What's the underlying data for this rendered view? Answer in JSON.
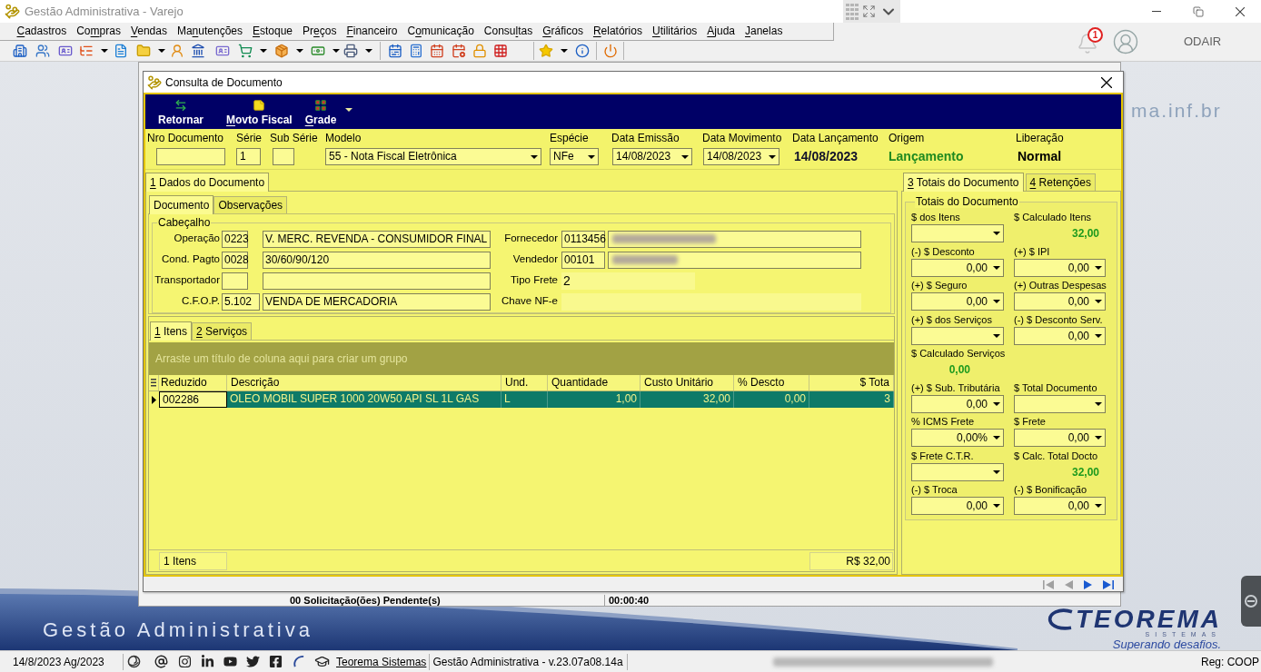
{
  "app_window": {
    "title": "Gestão Administrativa - Varejo"
  },
  "menu": [
    {
      "key": "C",
      "after": "adastros"
    },
    {
      "before": "Co",
      "key": "m",
      "after": "pras"
    },
    {
      "key": "V",
      "after": "endas"
    },
    {
      "before": "Ma",
      "key": "n",
      "after": "utenções"
    },
    {
      "key": "E",
      "after": "stoque"
    },
    {
      "before": "Pr",
      "key": "e",
      "after": "ços"
    },
    {
      "key": "F",
      "after": "inanceiro"
    },
    {
      "before": "C",
      "key": "o",
      "after": "municação"
    },
    {
      "before": "Consu",
      "key": "l",
      "after": "tas"
    },
    {
      "key": "G",
      "after": "ráficos"
    },
    {
      "key": "R",
      "after": "elatórios"
    },
    {
      "key": "U",
      "after": "tilitários"
    },
    {
      "key": "A",
      "after": "juda"
    },
    {
      "key": "J",
      "after": "anelas"
    }
  ],
  "user_area": {
    "notification_count": "1",
    "user_name": "ODAIR"
  },
  "desktop": {
    "website_fragment": "ma.inf.br",
    "background_window": {
      "pending_requests": "00 Solicitação(ões) Pendente(s)",
      "elapsed_time": "00:00:40"
    },
    "product_name": "Gestão Administrativa",
    "brand": "TEOREMA",
    "brand_tagline": "SISTEMAS",
    "slogan": "Superando desafios."
  },
  "dialog": {
    "title": "Consulta de Documento",
    "toolbar": [
      {
        "label": "Retornar",
        "dropdown": false
      },
      {
        "key": "M",
        "after": "ovto Fiscal",
        "dropdown": false
      },
      {
        "key": "G",
        "after": "rade",
        "dropdown": true
      }
    ],
    "header_fields": [
      {
        "kind": "input",
        "label": "Nro Documento"
      },
      {
        "kind": "input",
        "label": "Série",
        "value": "1"
      },
      {
        "kind": "input",
        "label": "Sub Série"
      },
      {
        "kind": "select",
        "label": "Modelo",
        "value": "55 - Nota Fiscal Eletrônica"
      },
      {
        "kind": "select",
        "label": "Espécie",
        "value": "NFe"
      },
      {
        "kind": "date",
        "label": "Data Emissão",
        "value": "14/08/2023"
      },
      {
        "kind": "date",
        "label": "Data Movimento",
        "value": "14/08/2023"
      },
      {
        "kind": "display",
        "label": "Data Lançamento",
        "value": "14/08/2023",
        "color": "#10102a"
      },
      {
        "kind": "display",
        "label": "Origem",
        "value": "Lançamento",
        "color": "#1f8a1f"
      },
      {
        "kind": "display",
        "label": "Liberação",
        "value": "Normal",
        "color": "#000000"
      }
    ],
    "left_panel": {
      "tabs": [
        {
          "key": "1",
          "after": " Dados do Documento",
          "selected": true
        }
      ],
      "document_tabs": [
        {
          "label": "Documento",
          "selected": true
        },
        {
          "label": "Observações",
          "selected": false
        }
      ],
      "cabecalho": {
        "title": "Cabeçalho",
        "left_rows": [
          {
            "label": "Operação",
            "code": "0223",
            "description": "V. MERC. REVENDA - CONSUMIDOR FINAL"
          },
          {
            "label": "Cond. Pagto",
            "code": "0028",
            "description": "30/60/90/120"
          },
          {
            "label": "Transportador"
          },
          {
            "label": "C.F.O.P.",
            "code": "5.102",
            "description": "VENDA DE MERCADORIA"
          }
        ],
        "right_rows": [
          {
            "kind": "lookup",
            "label": "Fornecedor",
            "code": "0113456",
            "redacted": true
          },
          {
            "kind": "lookup",
            "label": "Vendedor",
            "code": "00101",
            "redacted": true
          },
          {
            "kind": "readonly",
            "label": "Tipo Frete",
            "value": "2"
          },
          {
            "kind": "readonly",
            "label": "Chave NF-e"
          }
        ]
      },
      "item_tabs": [
        {
          "key": "1",
          "after": " Itens",
          "selected": true
        },
        {
          "key": "2",
          "after": " Serviços",
          "selected": false
        }
      ],
      "group_by_hint": "Arraste um título de coluna aqui para criar um grupo",
      "grid": {
        "columns": [
          "Reduzido",
          "Descrição",
          "Und.",
          "Quantidade",
          "Custo Unitário",
          "% Descto",
          "$ Tota"
        ],
        "rows": [
          {
            "selected": true,
            "cells": [
              "002286",
              "OLEO MOBIL SUPER 1000 20W50 API SL 1L GAS",
              "L",
              "1,00",
              "32,00",
              "0,00",
              "3"
            ]
          }
        ],
        "footer": {
          "count": "1 Itens",
          "total": "R$ 32,00"
        }
      }
    },
    "right_panel": {
      "tabs": [
        {
          "key": "3",
          "after": " Totais do Documento",
          "selected": true
        },
        {
          "key": "4",
          "after": " Retenções",
          "selected": false
        }
      ],
      "group_title": "Totais do Documento",
      "rows": [
        {
          "fields": [
            {
              "kind": "dropdown",
              "label": "$ dos Itens"
            },
            {
              "kind": "value",
              "label": "$ Calculado Itens",
              "value": "32,00"
            }
          ]
        },
        {
          "fields": [
            {
              "kind": "dropdown",
              "label": "(-) $ Desconto",
              "value": "0,00"
            },
            {
              "kind": "dropdown",
              "label": "(+) $ IPI",
              "value": "0,00"
            }
          ]
        },
        {
          "fields": [
            {
              "kind": "dropdown",
              "label": "(+) $ Seguro",
              "value": "0,00"
            },
            {
              "kind": "dropdown",
              "label": "(+) Outras Despesas",
              "value": "0,00"
            }
          ]
        },
        {
          "fields": [
            {
              "kind": "dropdown",
              "label": "(+) $ dos Serviços"
            },
            {
              "kind": "dropdown",
              "label": "(-) $ Desconto Serv.",
              "value": "0,00"
            }
          ]
        },
        {
          "fields": [
            {
              "kind": "value",
              "label": "$ Calculado Serviços",
              "value": "0,00"
            }
          ]
        },
        {
          "fields": [
            {
              "kind": "dropdown",
              "label": "(+) $ Sub. Tributária",
              "value": "0,00"
            },
            {
              "kind": "dropdown",
              "label": "$ Total Documento"
            }
          ]
        },
        {
          "fields": [
            {
              "kind": "dropdown",
              "label": "% ICMS Frete",
              "value": "0,00%"
            },
            {
              "kind": "dropdown",
              "label": "$ Frete",
              "value": "0,00"
            }
          ]
        },
        {
          "fields": [
            {
              "kind": "dropdown",
              "label": "$ Frete C.T.R."
            },
            {
              "kind": "value",
              "label": "$ Calc. Total Docto",
              "value": "32,00"
            }
          ]
        },
        {
          "fields": [
            {
              "kind": "dropdown",
              "label": "(-) $ Troca",
              "value": "0,00"
            },
            {
              "kind": "dropdown",
              "label": "(-) $ Bonificação",
              "value": "0,00"
            }
          ]
        }
      ]
    },
    "record_navigator": [
      {
        "kind": "first",
        "disabled": true
      },
      {
        "kind": "previous",
        "disabled": true
      },
      {
        "kind": "next",
        "disabled": false
      },
      {
        "kind": "last",
        "disabled": false
      }
    ]
  },
  "status_bar": {
    "date": "14/8/2023 Ag/2023",
    "link": "Teorema Sistemas",
    "version": "Gestão Administrativa - v.23.07a08.14a",
    "redacted": true,
    "registration": "Reg: COOP"
  }
}
